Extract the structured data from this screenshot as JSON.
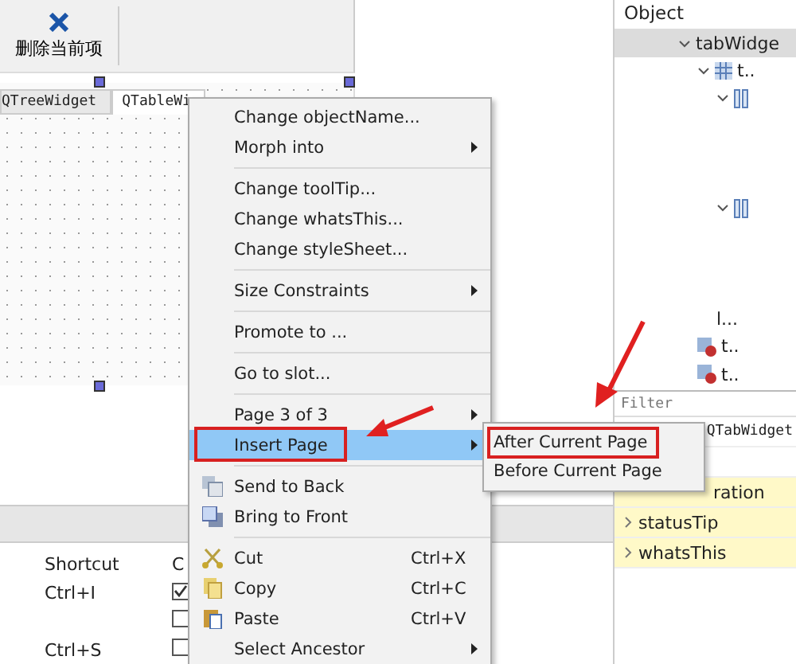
{
  "toolbar": {
    "buttons": [
      {
        "label": "删除当前项"
      }
    ]
  },
  "form_tabs": [
    {
      "label": "QTreeWidget",
      "selected": false
    },
    {
      "label": "QTableWi",
      "selected": true
    }
  ],
  "action_table": {
    "columns": [
      "Shortcut",
      "C"
    ],
    "rows": [
      {
        "shortcut": "Ctrl+I",
        "checked": true
      },
      {
        "checked": false
      },
      {
        "shortcut": "Ctrl+S",
        "checked": false
      }
    ]
  },
  "object_inspector": {
    "header": "Object",
    "tree": [
      {
        "label": "tabWidge",
        "expanded": true,
        "selected": true,
        "children": [
          {
            "label": "t..",
            "kind": "grid",
            "expanded": true,
            "selected": false,
            "children": [
              {
                "kind": "column",
                "expanded": true,
                "selected": false
              },
              {
                "kind": "column",
                "expanded": true,
                "selected": false
              },
              {
                "label": "l...",
                "selected": false
              }
            ]
          },
          {
            "label": "t..",
            "kind": "widget",
            "selected": false
          },
          {
            "label": "t..",
            "kind": "widget",
            "selected": false
          }
        ]
      }
    ]
  },
  "property_editor": {
    "filter_placeholder": "Filter",
    "class_name": "QTabWidget",
    "properties": [
      {
        "name": "ration",
        "kind": "partial",
        "expandable": false
      },
      {
        "name": "statusTip",
        "expandable": true
      },
      {
        "name": "whatsThis",
        "expandable": true
      }
    ]
  },
  "context_menu": {
    "items": [
      {
        "kind": "item",
        "label": "Change objectName...",
        "submenu": false,
        "highlighted": false
      },
      {
        "kind": "item",
        "label": "Morph into",
        "submenu": true,
        "highlighted": false
      },
      {
        "kind": "separator"
      },
      {
        "kind": "item",
        "label": "Change toolTip...",
        "submenu": false,
        "highlighted": false
      },
      {
        "kind": "item",
        "label": "Change whatsThis...",
        "submenu": false,
        "highlighted": false
      },
      {
        "kind": "item",
        "label": "Change styleSheet...",
        "submenu": false,
        "highlighted": false
      },
      {
        "kind": "separator"
      },
      {
        "kind": "item",
        "label": "Size Constraints",
        "submenu": true,
        "highlighted": false
      },
      {
        "kind": "separator"
      },
      {
        "kind": "item",
        "label": "Promote to ...",
        "submenu": false,
        "highlighted": false
      },
      {
        "kind": "separator"
      },
      {
        "kind": "item",
        "label": "Go to slot...",
        "submenu": false,
        "highlighted": false
      },
      {
        "kind": "separator"
      },
      {
        "kind": "item",
        "label": "Page 3 of 3",
        "submenu": true,
        "highlighted": false
      },
      {
        "kind": "item",
        "label": "Insert Page",
        "submenu": true,
        "highlighted": true
      },
      {
        "kind": "separator"
      },
      {
        "kind": "back",
        "label": "Send to Back",
        "submenu": false,
        "highlighted": false
      },
      {
        "kind": "front",
        "label": "Bring to Front",
        "submenu": false,
        "highlighted": false
      },
      {
        "kind": "separator"
      },
      {
        "kind": "cut",
        "label": "Cut",
        "shortcut": "Ctrl+X",
        "submenu": false,
        "highlighted": false
      },
      {
        "kind": "copy",
        "label": "Copy",
        "shortcut": "Ctrl+C",
        "submenu": false,
        "highlighted": false
      },
      {
        "kind": "paste",
        "label": "Paste",
        "shortcut": "Ctrl+V",
        "submenu": false,
        "highlighted": false
      },
      {
        "kind": "item",
        "label": "Select Ancestor",
        "submenu": true,
        "highlighted": false
      }
    ]
  },
  "submenu": {
    "items": [
      {
        "label": "After Current Page",
        "marked": true
      },
      {
        "label": "Before Current Page",
        "marked": false
      }
    ]
  }
}
